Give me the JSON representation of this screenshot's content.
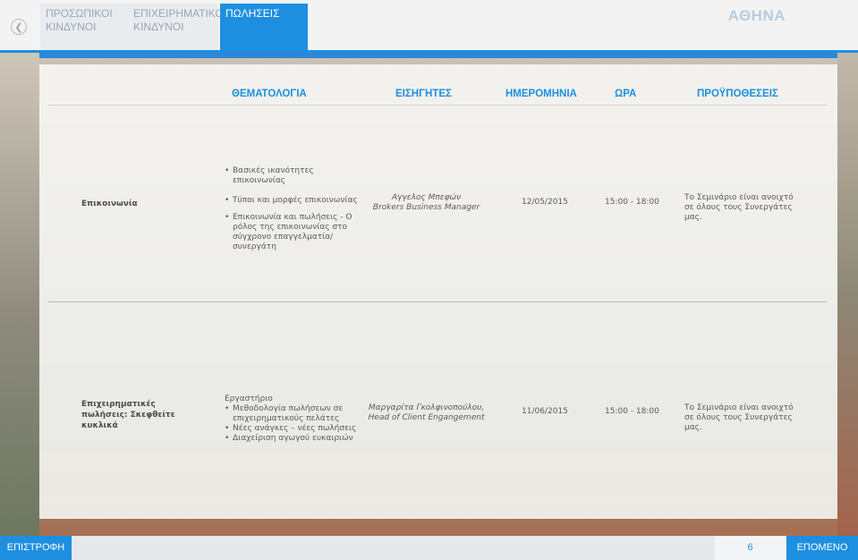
{
  "nav": {
    "tabs": [
      {
        "label": "ΠΡΟΣΩΠΙΚΟΙ ΚΙΝΔΥΝΟΙ",
        "active": false
      },
      {
        "label": "ΕΠΙΧΕΙΡΗΜΑΤΙΚΟΙ ΚΙΝΔΥΝΟΙ",
        "active": false
      },
      {
        "label": "ΠΩΛΗΣΕΙΣ",
        "active": true
      }
    ],
    "city": "ΑΘΗΝΑ",
    "back_icon": "chevron-left-icon"
  },
  "table": {
    "headers": {
      "topic": "ΘΕΜΑΤΟΛΟΓΙΑ",
      "speakers": "ΕΙΣΗΓΗΤΕΣ",
      "date": "ΗΜΕΡΟΜΗΝΙΑ",
      "time": "ΩΡΑ",
      "prereq": "ΠΡΟΫΠΟΘΕΣΕΙΣ"
    },
    "rows": [
      {
        "label": "Επικοινωνία",
        "topics": [
          "Βασικές ικανότητες επικοινωνίας",
          "Τύποι και μορφές επικοινωνίας",
          "Επικοινωνία και πωλήσεις - Ο ρόλος της επικοινωνίας στο σύγχρονο επαγγελματία/συνεργάτη"
        ],
        "speaker_name": "Αγγελος Μπεφών",
        "speaker_role": "Brokers Business Manager",
        "date": "12/05/2015",
        "time": "15:00 - 18:00",
        "prereq": "Το Σεμινάριο είναι ανοιχτό σε όλους τους Συνεργάτες μας."
      },
      {
        "label": "Επιχειρηματικές πωλήσεις: Σκεφθείτε κυκλικά",
        "intro": "Εργαστήριο",
        "topics": [
          "Μεθοδολογία πωλήσεων σε επιχειρηματικούς πελάτες",
          "Νέες ανάγκες – νέες πωλήσεις",
          "Διαχείριση αγωγού ευκαιριών"
        ],
        "speaker_name": "Μαργαρίτα Γκολφινοπούλου,",
        "speaker_role": "Head of Client Engangement",
        "date": "11/06/2015",
        "time": "15:00 - 18:00",
        "prereq": "Το Σεμινάριο είναι ανοιχτό σε όλους τους Συνεργάτες μας."
      }
    ]
  },
  "footer": {
    "prev_label": "ΕΠΙΣΤΡΟΦΗ",
    "page_number": "6",
    "next_label": "ΕΠΟΜΕΝΟ"
  },
  "colors": {
    "accent": "#1e8fe0",
    "text": "#5a5a5a"
  }
}
